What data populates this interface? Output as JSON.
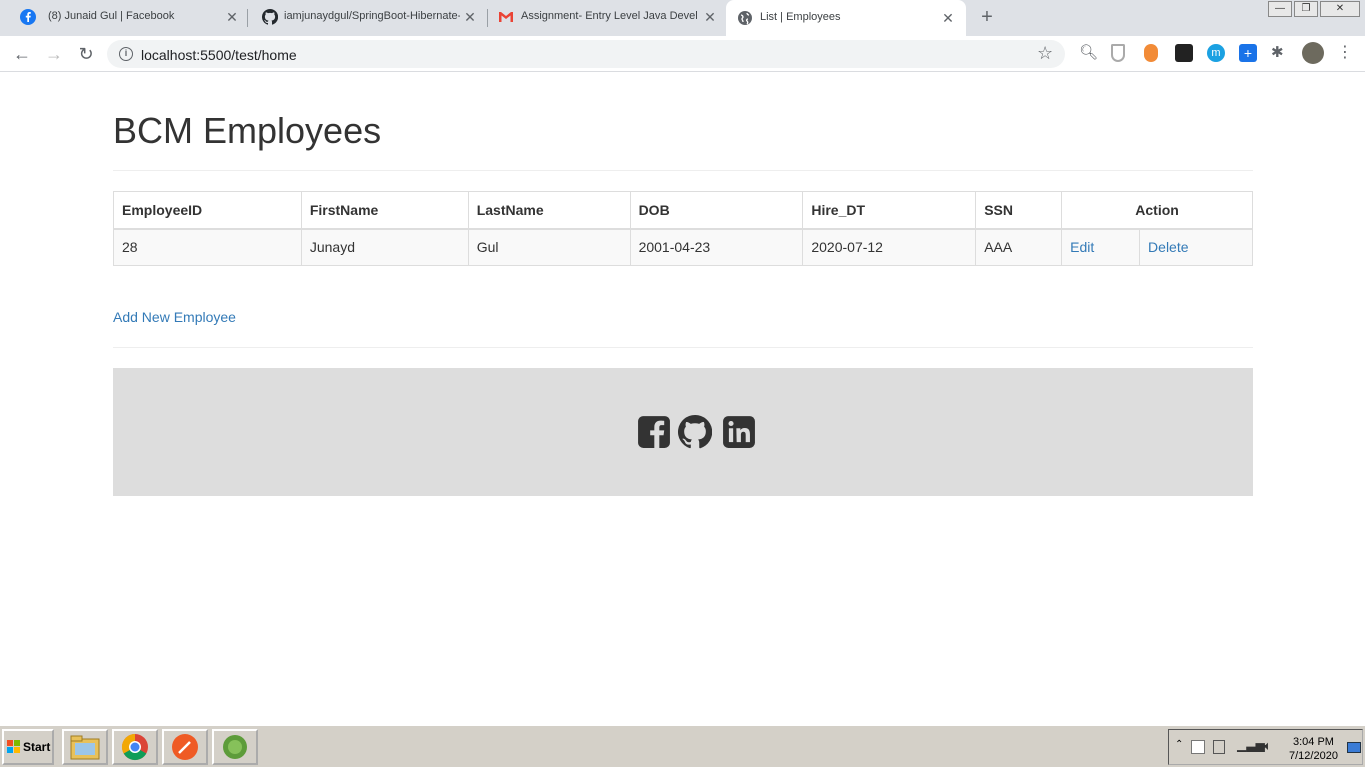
{
  "browser": {
    "tabs": [
      {
        "title": "(8) Junaid Gul | Facebook",
        "icon": "facebook-icon"
      },
      {
        "title": "iamjunaydgul/SpringBoot-Hibernate-",
        "icon": "github-icon"
      },
      {
        "title": "Assignment- Entry Level Java Devel",
        "icon": "gmail-icon"
      },
      {
        "title": "List | Employees",
        "icon": "globe-icon"
      }
    ],
    "url": "localhost:5500/test/home"
  },
  "page": {
    "title": "BCM Employees",
    "table": {
      "headers": [
        "EmployeeID",
        "FirstName",
        "LastName",
        "DOB",
        "Hire_DT",
        "SSN",
        "Action"
      ],
      "rows": [
        {
          "id": "28",
          "first": "Junayd",
          "last": "Gul",
          "dob": "2001-04-23",
          "hire": "2020-07-12",
          "ssn": "AAA",
          "edit": "Edit",
          "delete": "Delete"
        }
      ]
    },
    "add_link": "Add New Employee",
    "footer_icons": [
      "facebook-icon",
      "github-icon",
      "linkedin-icon"
    ]
  },
  "taskbar": {
    "start_label": "Start",
    "time": "3:04 PM",
    "date": "7/12/2020"
  },
  "colors": {
    "link": "#337ab7",
    "footer_bg": "#dddddd",
    "icon_dark": "#333333"
  }
}
